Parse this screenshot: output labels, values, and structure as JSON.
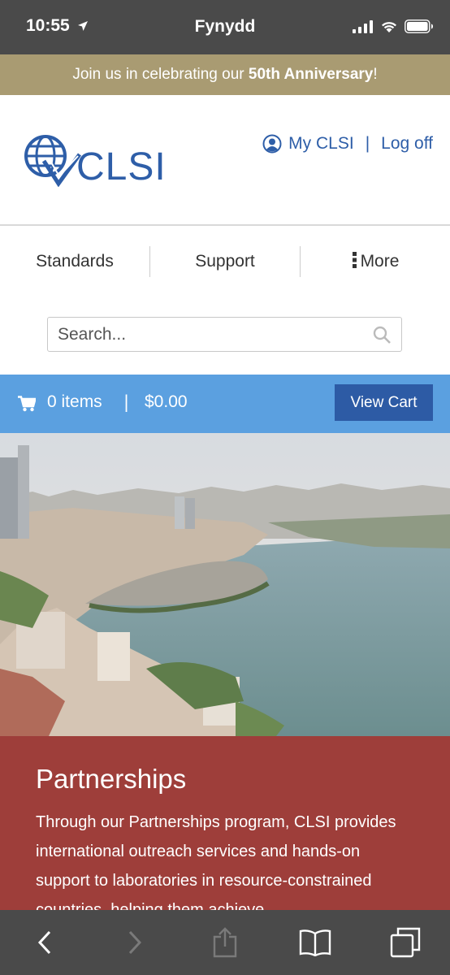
{
  "status_bar": {
    "time": "10:55",
    "carrier": "Fynydd"
  },
  "banner": {
    "prefix": "Join us in celebrating our ",
    "highlight": "50th Anniversary",
    "suffix": "!"
  },
  "header": {
    "logo_text": "CLSI",
    "my_account_label": "My CLSI",
    "separator": "|",
    "logoff_label": "Log off"
  },
  "nav": {
    "items": [
      {
        "label": "Standards"
      },
      {
        "label": "Support"
      },
      {
        "label": "More"
      }
    ]
  },
  "search": {
    "placeholder": "Search..."
  },
  "cart": {
    "items_text": "0 items",
    "separator": "|",
    "total": "$0.00",
    "view_cart_label": "View Cart"
  },
  "partnerships": {
    "title": "Partnerships",
    "body": "Through our Partnerships program, CLSI provides international outreach services and hands-on support to laboratories in resource-constrained countries, helping them achieve"
  },
  "colors": {
    "status_bar": "#4a4a4a",
    "banner": "#a99b72",
    "brand_blue": "#2e5ea8",
    "cart_bar": "#5ba0e0",
    "view_cart_button": "#2d5ba5",
    "partnerships_bg": "#9e3e3a"
  },
  "icons": {
    "status_location": "location-arrow-icon",
    "status_signal": "cellular-signal-icon",
    "status_wifi": "wifi-icon",
    "status_battery": "battery-icon",
    "account": "user-circle-icon",
    "more": "vertical-ellipsis-icon",
    "search": "search-icon",
    "cart": "shopping-cart-icon",
    "toolbar": [
      "back-icon",
      "forward-icon",
      "share-icon",
      "bookmarks-icon",
      "tabs-icon"
    ]
  }
}
